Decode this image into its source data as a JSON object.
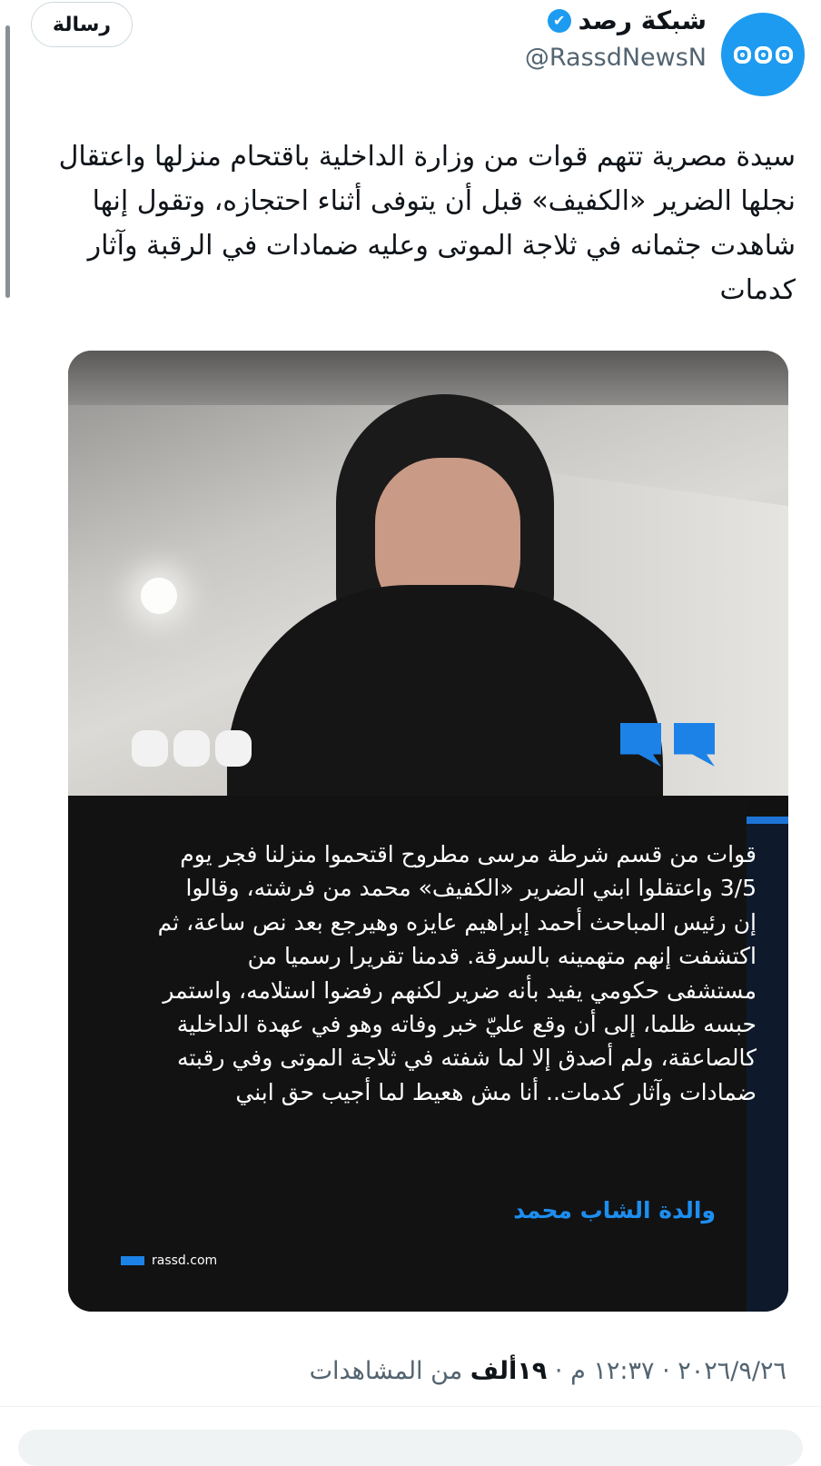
{
  "account": {
    "display_name": "شبكة رصد",
    "handle": "@RassdNewsN",
    "verified_icon": "✔",
    "message_button": "رسالة"
  },
  "tweet": {
    "text": "سيدة مصرية تتهم قوات من وزارة الداخلية باقتحام منزلها واعتقال نجلها الضرير «الكفيف» قبل أن يتوفى أثناء احتجازه، وتقول إنها شاهدت جثمانه في ثلاجة الموتى وعليه ضمادات في الرقبة وآثار كدمات"
  },
  "media": {
    "quote_text": "قوات من قسم شرطة مرسى مطروح اقتحموا منزلنا فجر يوم 3/5 واعتقلوا ابني الضرير «الكفيف» محمد من فرشته، وقالوا إن رئيس المباحث أحمد إبراهيم عايزه وهيرجع بعد نص ساعة، ثم اكتشفت إنهم متهمينه بالسرقة. قدمنا تقريرا رسميا من مستشفى حكومي يفيد بأنه ضرير لكنهم رفضوا استلامه، واستمر حبسه ظلما، إلى أن وقع عليّ خبر وفاته وهو في عهدة الداخلية كالصاعقة، ولم أصدق إلا لما شفته في ثلاجة الموتى وفي رقبته ضمادات وآثار كدمات.. أنا مش هعيط لما أجيب حق ابني",
    "quote_author": "والدة الشاب محمد",
    "site": "rassd.com"
  },
  "meta": {
    "date": "٢٠٢٦/٩/٢٦",
    "separator": "·",
    "time": "١٢:٣٧ م",
    "views_count": "١٩ألف",
    "views_label": "من المشاهدات"
  },
  "colors": {
    "accent": "#1d9bf0",
    "quote_blue": "#1d82e8",
    "text": "#0f1419",
    "secondary": "#536471"
  }
}
